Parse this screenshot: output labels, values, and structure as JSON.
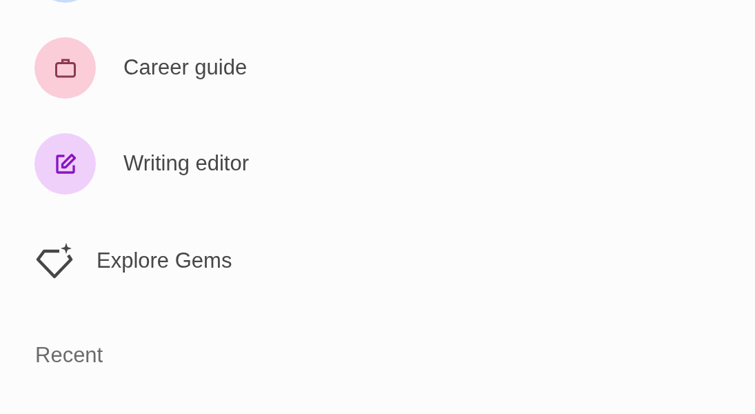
{
  "gems": [
    {
      "color": "#c6dcfa",
      "kind": "partial"
    },
    {
      "label": "Career guide",
      "color": "#fbcdd8",
      "kind": "briefcase"
    },
    {
      "label": "Writing editor",
      "color": "#efd0fb",
      "kind": "edit"
    }
  ],
  "explore": {
    "label": "Explore Gems"
  },
  "recent": {
    "heading": "Recent"
  }
}
